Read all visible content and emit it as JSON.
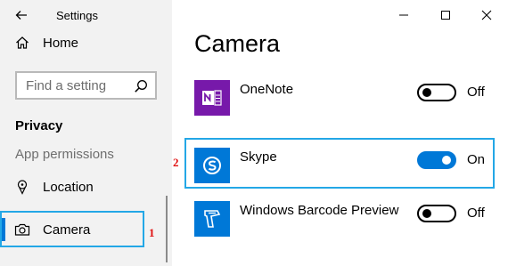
{
  "window": {
    "title": "Settings"
  },
  "sidebar": {
    "home_label": "Home",
    "search": {
      "placeholder": "Find a setting"
    },
    "section_title": "Privacy",
    "section_subtitle": "App permissions",
    "items": [
      {
        "label": "Location",
        "icon": "location-icon"
      },
      {
        "label": "Camera",
        "icon": "camera-icon",
        "selected": true
      }
    ]
  },
  "main": {
    "title": "Camera",
    "apps": [
      {
        "name": "OneNote",
        "state": "Off",
        "enabled": false,
        "icon": "onenote-icon",
        "icon_color": "#7719aa"
      },
      {
        "name": "Skype",
        "state": "On",
        "enabled": true,
        "icon": "skype-icon",
        "icon_color": "#0078d7"
      },
      {
        "name": "Windows Barcode Preview",
        "state": "Off",
        "enabled": false,
        "icon": "barcode-scanner-icon",
        "icon_color": "#0078d7"
      }
    ]
  },
  "annotations": [
    {
      "number": "1",
      "target": "Camera"
    },
    {
      "number": "2",
      "target": "Skype"
    }
  ],
  "colors": {
    "accent": "#0078d7",
    "callout_border": "#23a7e6",
    "callout_number": "#e01010",
    "sidebar_bg": "#f2f2f2"
  }
}
